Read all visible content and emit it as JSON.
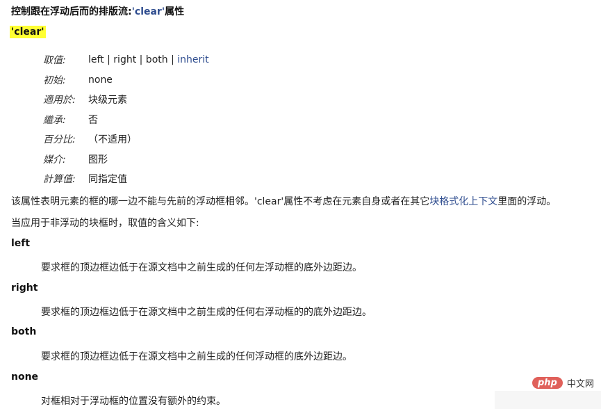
{
  "title": {
    "prefix": "控制跟在浮动后而的排版流:",
    "code": "'clear'",
    "suffix": "属性"
  },
  "property_name": "'clear'",
  "definitions": [
    {
      "label": "取值:",
      "value": "left | right | both | ",
      "link": "inherit"
    },
    {
      "label": "初始:",
      "value": "none"
    },
    {
      "label": "適用於:",
      "value": "块级元素"
    },
    {
      "label": "繼承:",
      "value": "否"
    },
    {
      "label": "百分比:",
      "value": "（不适用）"
    },
    {
      "label": "媒介:",
      "value": "图形"
    },
    {
      "label": "計算值:",
      "value": "同指定值"
    }
  ],
  "paragraph1": {
    "text": "该属性表明元素的框的哪一边不能与先前的浮动框相邻。'clear'属性不考虑在元素自身或者在其它",
    "link": "块格式化上下文",
    "suffix": "里面的浮动。"
  },
  "paragraph2": "当应用于非浮动的块框时，取值的含义如下:",
  "values": [
    {
      "term": "left",
      "desc": "要求框的顶边框边低于在源文档中之前生成的任何左浮动框的底外边距边。"
    },
    {
      "term": "right",
      "desc": "要求框的顶边框边低于在源文档中之前生成的任何右浮动框的的底外边距边。"
    },
    {
      "term": "both",
      "desc": "要求框的顶边框边低于在源文档中之前生成的任何浮动框的底外边距边。"
    },
    {
      "term": "none",
      "desc": "对框相对于浮动框的位置没有额外的约束。"
    }
  ],
  "watermark": {
    "logo": "php",
    "text": "中文网"
  },
  "colors": {
    "link": "#2f4d8f",
    "highlight": "#ffff33"
  }
}
